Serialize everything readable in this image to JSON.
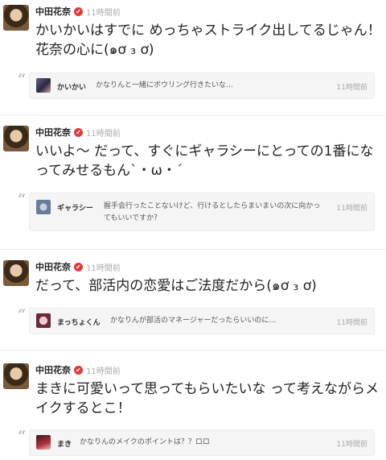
{
  "posts": [
    {
      "author": "中田花奈",
      "time": "11時間前",
      "text": "かいかいはすでに めっちゃストライク出してるじゃん！花奈の心に(๑ơ ₃ ơ)",
      "reply": {
        "name": "かいかい",
        "text": "かなりんと一緒にボウリング行きたいな…",
        "time": "11時間前"
      }
    },
    {
      "author": "中田花奈",
      "time": "11時間前",
      "text": "いいよ〜 だって、すぐにギャラシーにとっての1番になってみせるもん`・ω・´",
      "reply": {
        "name": "ギャラシー",
        "text": "握手会行ったことないけど、行けるとしたらまいまいの次に向かってもいいですか？",
        "time": "11時間前"
      }
    },
    {
      "author": "中田花奈",
      "time": "11時間前",
      "text": "だって、部活内の恋愛はご法度だから(๑ơ ₃ ơ)",
      "reply": {
        "name": "まっちょくん",
        "text": "かなりんが部活のマネージャーだったらいいのに…",
        "time": "11時間前"
      }
    },
    {
      "author": "中田花奈",
      "time": "11時間前",
      "text": "まきに可愛いって思ってもらいたいな って考えながらメイクするとこ！",
      "reply": {
        "name": "まき",
        "text": "かなりんのメイクのポイントは？？ロロ",
        "time": "11時間前"
      }
    }
  ],
  "icons": {
    "verified": "✔",
    "quote": "“"
  },
  "colors": {
    "verified": "#e0393b",
    "reply_bg": "#f5f5f5",
    "time": "#aaaaaa"
  }
}
